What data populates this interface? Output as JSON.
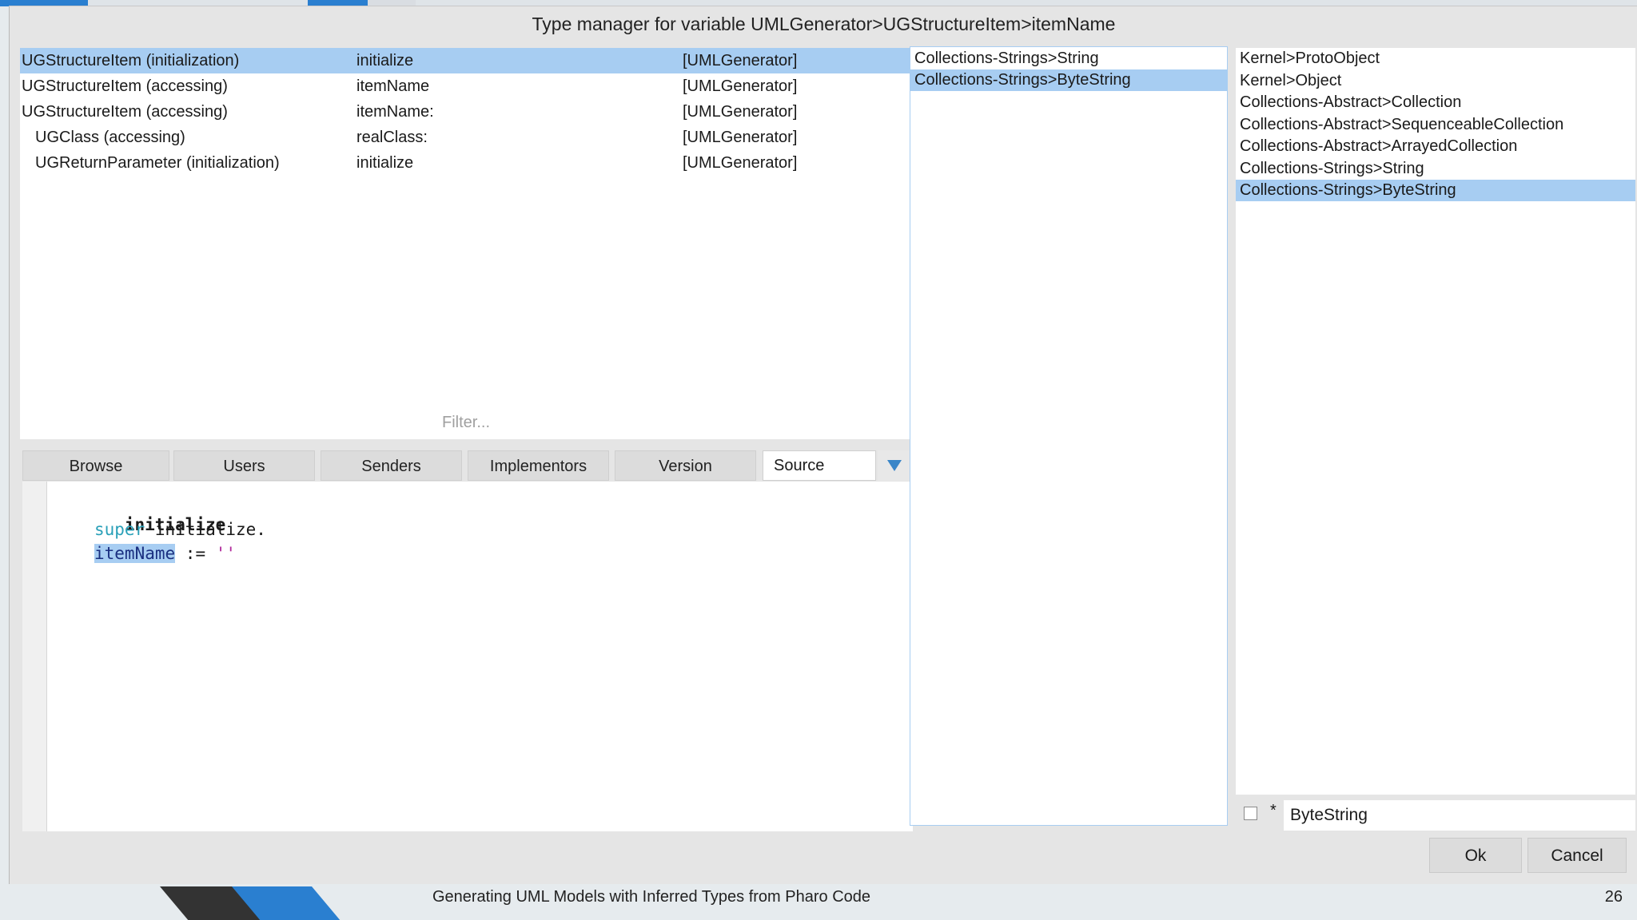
{
  "window": {
    "title": "Type manager for variable UMLGenerator>UGStructureItem>itemName"
  },
  "methods": [
    {
      "class": "UGStructureItem (initialization)",
      "selector": "initialize",
      "package": "[UMLGenerator]",
      "selected": true,
      "indent": false
    },
    {
      "class": "UGStructureItem (accessing)",
      "selector": "itemName",
      "package": "[UMLGenerator]",
      "selected": false,
      "indent": false
    },
    {
      "class": "UGStructureItem (accessing)",
      "selector": "itemName:",
      "package": "[UMLGenerator]",
      "selected": false,
      "indent": false
    },
    {
      "class": "UGClass (accessing)",
      "selector": "realClass:",
      "package": "[UMLGenerator]",
      "selected": false,
      "indent": true
    },
    {
      "class": "UGReturnParameter (initialization)",
      "selector": "initialize",
      "package": "[UMLGenerator]",
      "selected": false,
      "indent": true
    }
  ],
  "filter": {
    "placeholder": "Filter..."
  },
  "toolbar": {
    "browse": "Browse",
    "users": "Users",
    "senders": "Senders",
    "implementors": "Implementors",
    "version": "Version",
    "source_select": "Source"
  },
  "code": {
    "method_name": "initialize",
    "line2_keyword": "super",
    "line2_rest": " initialize.",
    "line3_var": "itemName",
    "line3_op": " := ",
    "line3_str": "''"
  },
  "types": [
    {
      "label": "Collections-Strings>String",
      "selected": false
    },
    {
      "label": "Collections-Strings>ByteString",
      "selected": true
    }
  ],
  "hierarchy": [
    {
      "label": "Kernel>ProtoObject",
      "selected": false
    },
    {
      "label": "Kernel>Object",
      "selected": false
    },
    {
      "label": "Collections-Abstract>Collection",
      "selected": false
    },
    {
      "label": "Collections-Abstract>SequenceableCollection",
      "selected": false
    },
    {
      "label": "Collections-Abstract>ArrayedCollection",
      "selected": false
    },
    {
      "label": "Collections-Strings>String",
      "selected": false
    },
    {
      "label": "Collections-Strings>ByteString",
      "selected": true
    }
  ],
  "type_entry": {
    "star": "*",
    "value": "ByteString",
    "checked": false
  },
  "buttons": {
    "ok": "Ok",
    "cancel": "Cancel"
  },
  "footer": {
    "text": "Generating UML Models with Inferred Types from Pharo Code",
    "page": "26"
  },
  "colors": {
    "selection": "#a7cdf2",
    "keyword": "#2aa0b8",
    "string": "#b0279a",
    "accent": "#2a7fd0"
  }
}
